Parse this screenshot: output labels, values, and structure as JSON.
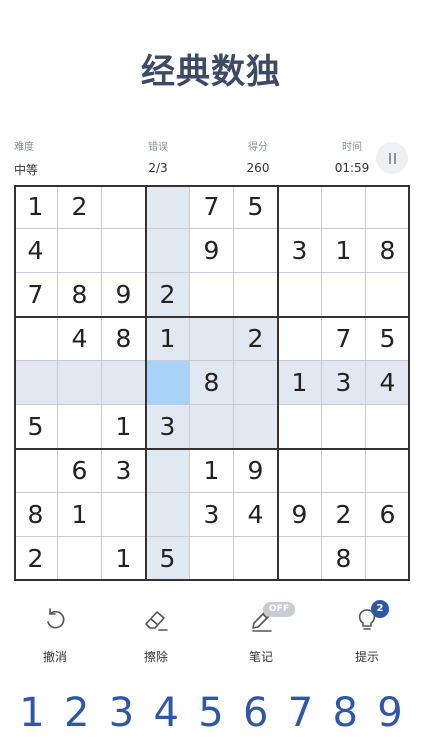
{
  "title": "经典数独",
  "stats": {
    "difficulty": {
      "label": "难度",
      "value": "中等"
    },
    "mistakes": {
      "label": "错误",
      "value": "2/3"
    },
    "score": {
      "label": "得分",
      "value": "260"
    },
    "time": {
      "label": "时间",
      "value": "01:59"
    }
  },
  "board": {
    "selected": {
      "row": 4,
      "col": 3
    },
    "rows": [
      [
        "1",
        "2",
        "",
        "",
        "7",
        "5",
        "",
        "",
        ""
      ],
      [
        "4",
        "",
        "",
        "",
        "9",
        "",
        "3",
        "1",
        "8"
      ],
      [
        "7",
        "8",
        "9",
        "2",
        "",
        "",
        "",
        "",
        ""
      ],
      [
        "",
        "4",
        "8",
        "1",
        "",
        "2",
        "",
        "7",
        "5"
      ],
      [
        "",
        "",
        "",
        "",
        "8",
        "",
        "1",
        "3",
        "4"
      ],
      [
        "5",
        "",
        "1",
        "3",
        "",
        "",
        "",
        "",
        ""
      ],
      [
        "",
        "6",
        "3",
        "",
        "1",
        "9",
        "",
        "",
        ""
      ],
      [
        "8",
        "1",
        "",
        "",
        "3",
        "4",
        "9",
        "2",
        "6"
      ],
      [
        "2",
        "",
        "1",
        "5",
        "",
        "",
        "",
        "8",
        ""
      ]
    ]
  },
  "tools": {
    "undo": "撤消",
    "erase": "擦除",
    "notes": "笔记",
    "notes_state": "OFF",
    "hint": "提示",
    "hint_count": "2"
  },
  "numpad": [
    "1",
    "2",
    "3",
    "4",
    "5",
    "6",
    "7",
    "8",
    "9"
  ],
  "colors": {
    "accent": "#2f57a8",
    "title": "#3d4a66",
    "highlight": "#e2e8f1",
    "selected": "#a8d2f7"
  }
}
